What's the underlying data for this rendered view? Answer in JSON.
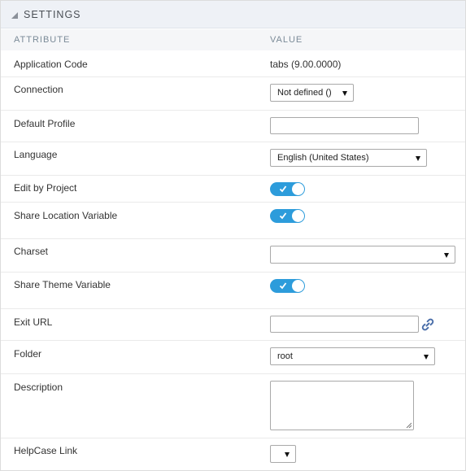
{
  "header": {
    "title": "SETTINGS",
    "collapse_icon": "collapse-triangle-icon"
  },
  "columns": {
    "attribute": "ATTRIBUTE",
    "value": "VALUE"
  },
  "fields": {
    "application_code": {
      "label": "Application Code",
      "value": "tabs (9.00.0000)"
    },
    "connection": {
      "label": "Connection",
      "selected": "Not defined ()"
    },
    "default_profile": {
      "label": "Default Profile",
      "value": ""
    },
    "language": {
      "label": "Language",
      "selected": "English (United States)"
    },
    "edit_by_project": {
      "label": "Edit by Project",
      "checked": true
    },
    "share_location_variable": {
      "label": "Share Location Variable",
      "checked": true
    },
    "charset": {
      "label": "Charset",
      "selected": ""
    },
    "share_theme_variable": {
      "label": "Share Theme Variable",
      "checked": true
    },
    "exit_url": {
      "label": "Exit URL",
      "value": "",
      "icon": "link-icon"
    },
    "folder": {
      "label": "Folder",
      "selected": "root"
    },
    "description": {
      "label": "Description",
      "value": ""
    },
    "helpcase_link": {
      "label": "HelpCase Link",
      "selected": ""
    }
  },
  "colors": {
    "toggle_on": "#2d9cdb",
    "header_bg": "#eef1f6",
    "column_header_text": "#7b8b98",
    "link_icon": "#4a6ea9"
  }
}
